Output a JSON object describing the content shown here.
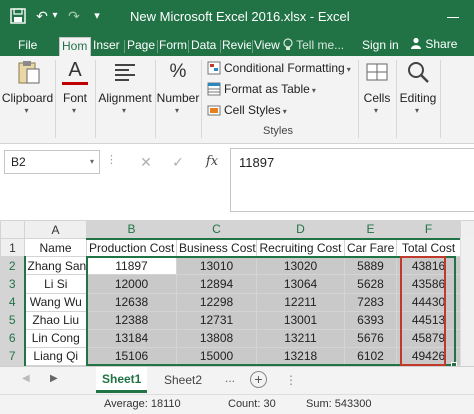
{
  "window": {
    "title": "New Microsoft Excel 2016.xlsx - Excel",
    "qat_icons": [
      "save-icon",
      "undo-icon",
      "redo-icon",
      "customize-qat-icon"
    ],
    "qat_glyphs": {
      "undo": "↶",
      "undo_caret": "▾",
      "redo": "↷",
      "customize": "▾"
    },
    "accent": "#217346"
  },
  "tabs": {
    "items": [
      {
        "label": "File",
        "active": false
      },
      {
        "label": "Hom",
        "active": true
      },
      {
        "label": "Inser",
        "active": false
      },
      {
        "label": "Page",
        "active": false
      },
      {
        "label": "Form",
        "active": false
      },
      {
        "label": "Data",
        "active": false
      },
      {
        "label": "Revie",
        "active": false
      },
      {
        "label": "View",
        "active": false
      }
    ],
    "tell_me": "Tell me...",
    "tell_me_icon": "lightbulb-icon",
    "sign_in": "Sign in",
    "share": "Share",
    "share_icon": "person-icon"
  },
  "ribbon": {
    "clipboard": "Clipboard",
    "font": "Font",
    "font_glyph": "A",
    "alignment": "Alignment",
    "number": "Number",
    "number_glyph": "%",
    "conditional_formatting": "Conditional Formatting",
    "format_as_table": "Format as Table",
    "cell_styles": "Cell Styles",
    "styles_group": "Styles",
    "cells": "Cells",
    "editing": "Editing",
    "caret": "▾"
  },
  "formula_bar": {
    "name_box": "B2",
    "name_caret": "▾",
    "dots": "⋮",
    "cancel": "✕",
    "enter": "✓",
    "fx": "fx",
    "value": "11897"
  },
  "sheet": {
    "corner": "",
    "columns": [
      "A",
      "B",
      "C",
      "D",
      "E",
      "F"
    ],
    "selected_columns": [
      "B",
      "C",
      "D",
      "E",
      "F"
    ],
    "header_row": {
      "index": "1",
      "cells": [
        "Name",
        "Production Cost",
        "Business Cost",
        "Recruiting Cost",
        "Car Fare",
        "Total Cost"
      ]
    },
    "rows": [
      {
        "index": "2",
        "name": "Zhang San",
        "values": [
          "11897",
          "13010",
          "13020",
          "5889",
          "43816"
        ]
      },
      {
        "index": "3",
        "name": "Li Si",
        "values": [
          "12000",
          "12894",
          "13064",
          "5628",
          "43586"
        ]
      },
      {
        "index": "4",
        "name": "Wang Wu",
        "values": [
          "12638",
          "12298",
          "12211",
          "7283",
          "44430"
        ]
      },
      {
        "index": "5",
        "name": "Zhao Liu",
        "values": [
          "12388",
          "12731",
          "13001",
          "6393",
          "44513"
        ]
      },
      {
        "index": "6",
        "name": "Lin Cong",
        "values": [
          "13184",
          "13808",
          "13211",
          "5676",
          "45879"
        ]
      },
      {
        "index": "7",
        "name": "Liang Qi",
        "values": [
          "15106",
          "15000",
          "13218",
          "6102",
          "49426"
        ]
      }
    ],
    "active_cell": "B2"
  },
  "sheet_tabs": {
    "items": [
      {
        "label": "Sheet1",
        "active": true
      },
      {
        "label": "Sheet2",
        "active": false
      }
    ],
    "nav_prev": "◀",
    "nav_next": "▶",
    "more": "...",
    "add": "+",
    "sep": "⋮"
  },
  "status": {
    "average": "Average: 18110",
    "count": "Count: 30",
    "sum": "Sum: 543300"
  }
}
